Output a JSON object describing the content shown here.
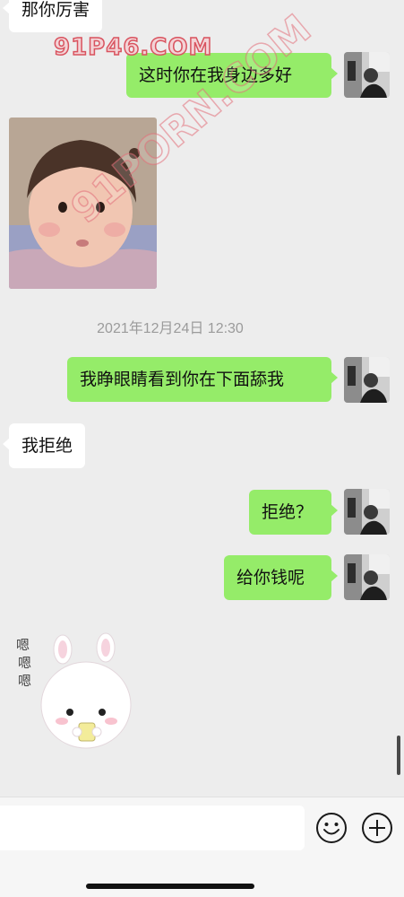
{
  "messages": {
    "m1": "那你厉害",
    "m2": "这时你在我身边多好",
    "m3": "我睁眼睛看到你在下面舔我",
    "m4": "我拒绝",
    "m5": "拒绝？",
    "m6": "给你钱呢"
  },
  "timestamp": "2021年12月24日 12:30",
  "sticker": {
    "text": "嗯 嗯 嗯"
  },
  "watermark": {
    "top": "91P46.COM",
    "diagonal": "91PORN.COM"
  },
  "input": {
    "value": "",
    "placeholder": ""
  },
  "icons": {
    "emoji": "smiley-face-icon",
    "plus": "plus-circle-icon"
  },
  "colors": {
    "chat_background": "#ededed",
    "outgoing_bubble": "#95ec69",
    "incoming_bubble": "#ffffff"
  }
}
